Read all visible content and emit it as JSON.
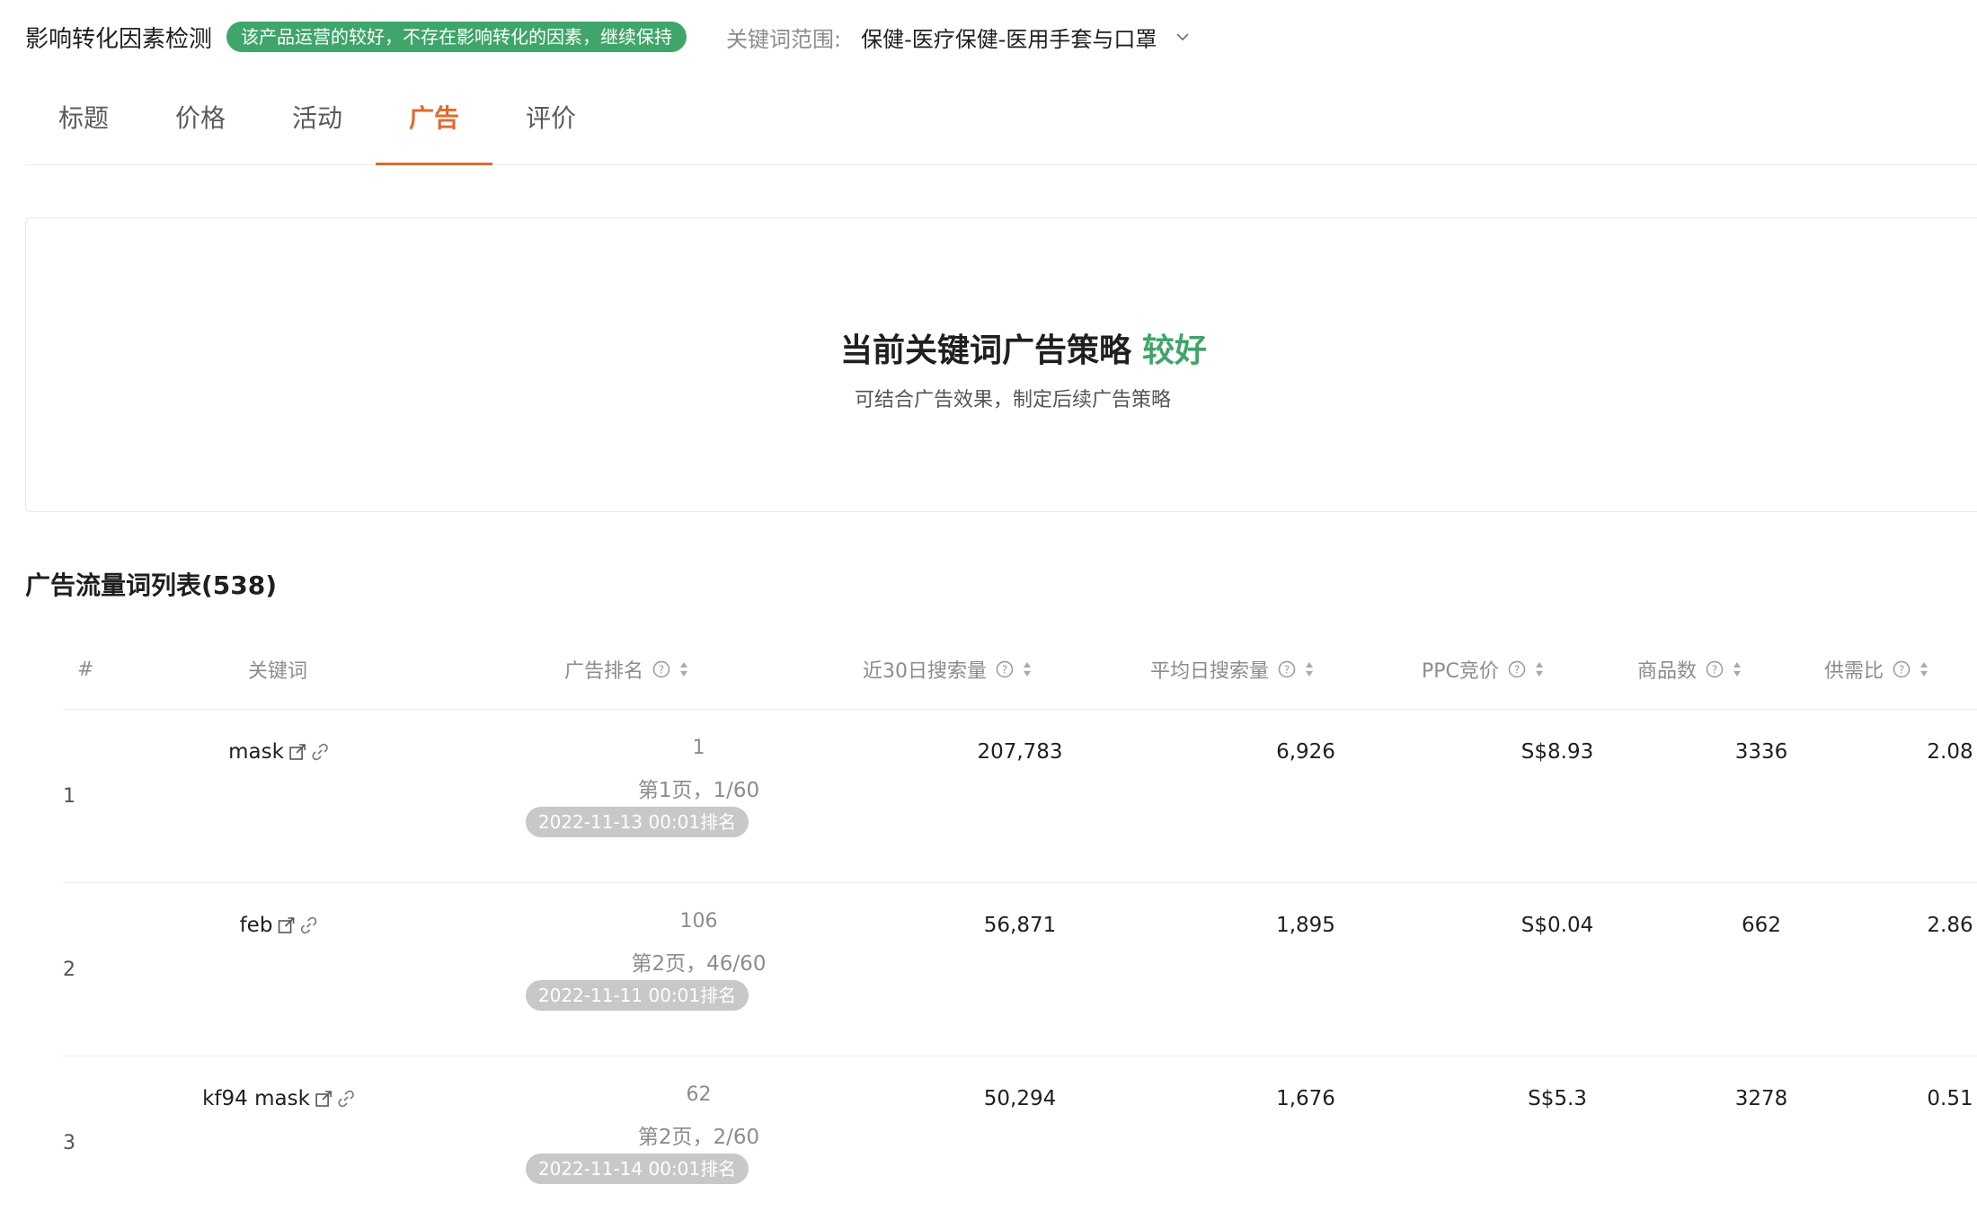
{
  "header": {
    "title": "影响转化因素检测",
    "status_badge": "该产品运营的较好，不存在影响转化的因素，继续保持",
    "scope_label": "关键词范围:",
    "scope_value": "保健-医疗保健-医用手套与口罩"
  },
  "tabs": [
    {
      "label": "标题",
      "active": false
    },
    {
      "label": "价格",
      "active": false
    },
    {
      "label": "活动",
      "active": false
    },
    {
      "label": "广告",
      "active": true
    },
    {
      "label": "评价",
      "active": false
    }
  ],
  "summary": {
    "title": "当前关键词广告策略",
    "rating": "较好",
    "subtitle": "可结合广告效果，制定后续广告策略"
  },
  "section": {
    "title": "广告流量词列表(538)"
  },
  "table": {
    "headers": {
      "index": "#",
      "keyword": "关键词",
      "rank": "广告排名",
      "search30": "近30日搜索量",
      "avg_search": "平均日搜索量",
      "ppc": "PPC竞价",
      "goods": "商品数",
      "ratio": "供需比"
    },
    "rows": [
      {
        "index": "1",
        "keyword": "mask",
        "rank": "1",
        "rank_page": "第1页，1/60",
        "rank_date": "2022-11-13 00:01排名",
        "search30": "207,783",
        "avg_search": "6,926",
        "ppc": "S$8.93",
        "goods": "3336",
        "ratio": "2.08"
      },
      {
        "index": "2",
        "keyword": "feb",
        "rank": "106",
        "rank_page": "第2页，46/60",
        "rank_date": "2022-11-11 00:01排名",
        "search30": "56,871",
        "avg_search": "1,895",
        "ppc": "S$0.04",
        "goods": "662",
        "ratio": "2.86"
      },
      {
        "index": "3",
        "keyword": "kf94 mask",
        "rank": "62",
        "rank_page": "第2页，2/60",
        "rank_date": "2022-11-14 00:01排名",
        "search30": "50,294",
        "avg_search": "1,676",
        "ppc": "S$5.3",
        "goods": "3278",
        "ratio": "0.51"
      }
    ]
  },
  "colors": {
    "accent": "#e06b2c",
    "good": "#3fa56a",
    "badge_gray": "#c8c8c8"
  }
}
